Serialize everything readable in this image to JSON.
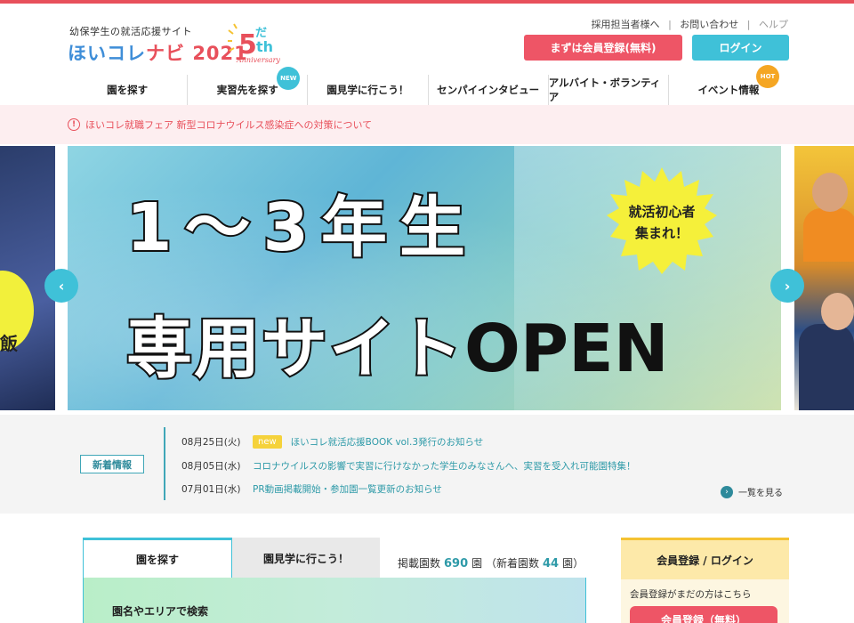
{
  "header": {
    "tagline": "幼保学生の就活応援サイト",
    "logo_hoi": "ほいコレ",
    "logo_navi": "ナビ",
    "logo_year": "2021",
    "anniversary_number": "5",
    "anniversary_suffix": "th",
    "anniversary_kana": "だ",
    "anniversary_word": "Anniversary",
    "links": {
      "recruiter": "採用担当者様へ",
      "contact": "お問い合わせ",
      "help": "ヘルプ",
      "sep": "|"
    },
    "register_label": "まずは会員登録(無料)",
    "login_label": "ログイン"
  },
  "nav": {
    "items": [
      {
        "label": "園を探す",
        "badge": ""
      },
      {
        "label": "実習先を探す",
        "badge": "NEW"
      },
      {
        "label": "園見学に行こう！",
        "badge": ""
      },
      {
        "label": "センパイインタビュー",
        "badge": ""
      },
      {
        "label": "アルバイト・ボランティア",
        "badge": ""
      },
      {
        "label": "イベント情報",
        "badge": "HOT"
      }
    ]
  },
  "notice": {
    "icon": "!",
    "text": "ほいコレ就職フェア 新型コロナウイルス感染症への対策について"
  },
  "hero": {
    "line1": "1〜3年生",
    "line2": "専用サイト",
    "line2_open": "OPEN",
    "burst_line1": "就活初心者",
    "burst_line2": "集まれ！",
    "side_left_char": "飯",
    "arrow_left": "‹",
    "arrow_right": "›"
  },
  "news": {
    "label": "新着情報",
    "items": [
      {
        "date": "08月25日(火)",
        "badge": "new",
        "title": "ほいコレ就活応援BOOK vol.3発行のお知らせ"
      },
      {
        "date": "08月05日(水)",
        "badge": "",
        "title": "コロナウイルスの影響で実習に行けなかった学生のみなさんへ、実習を受入れ可能園特集！"
      },
      {
        "date": "07月01日(水)",
        "badge": "",
        "title": "PR動画掲載開始・参加園一覧更新のお知らせ"
      }
    ],
    "more_label": "一覧を見る",
    "more_icon": "›"
  },
  "search": {
    "tabs": [
      "園を探す",
      "園見学に行こう！"
    ],
    "count_label": "掲載園数",
    "count_value": "690",
    "count_unit": "園",
    "new_label": "（新着園数",
    "new_value": "44",
    "new_unit": "園）",
    "panel_title": "園名やエリアで検索"
  },
  "side_panel": {
    "title": "会員登録 / ログイン",
    "note": "会員登録がまだの方はこちら",
    "button": "会員登録（無料）"
  },
  "colors": {
    "accent_red": "#e8505b",
    "accent_cyan": "#3fc1d8",
    "teal": "#2e9aa8",
    "yellow": "#f5c232"
  }
}
